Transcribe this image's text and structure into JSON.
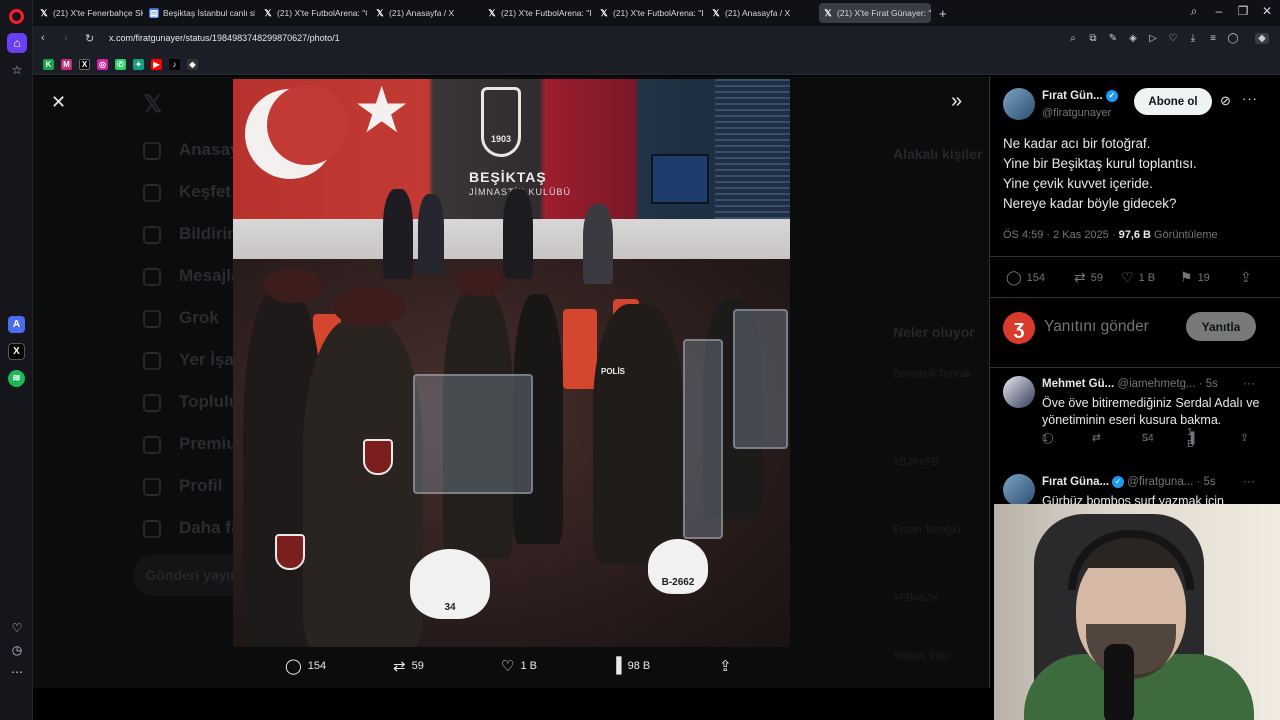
{
  "browser": {
    "tabs": [
      {
        "label": "(21) X'te Fenerbahçe SK: \"",
        "icon": "x-icon",
        "active": false
      },
      {
        "label": "Beşiktaş İstanbul canlı skor",
        "icon": "news-icon",
        "active": false
      },
      {
        "label": "(21) X'te FutbolArena: \"Or",
        "icon": "x-icon",
        "active": false
      },
      {
        "label": "(21) Anasayfa / X",
        "icon": "x-icon",
        "active": false
      },
      {
        "label": "(21) X'te FutbolArena: \"Fe",
        "icon": "x-icon",
        "active": false
      },
      {
        "label": "(21) X'te FutbolArena: \"Be",
        "icon": "x-icon",
        "active": false
      },
      {
        "label": "(21) Anasayfa / X",
        "icon": "x-icon",
        "active": false
      },
      {
        "label": "(21) X'te Fırat Günayer: \"N",
        "icon": "x-icon",
        "active": true
      }
    ],
    "new_tab_label": "+",
    "url": "x.com/firatgunayer/status/1984983748299870627/photo/1"
  },
  "background_nav": [
    "Anasayfa",
    "Keşfet",
    "Bildirimler",
    "Mesajlar",
    "Grok",
    "Yer İşaretleri",
    "Topluluklar",
    "Premium",
    "Profil",
    "Daha fazla"
  ],
  "background_post_button": "Gönderi yayınla",
  "background_right": {
    "related_title": "Alakalı kişiler",
    "trends_title": "Neler oluyor",
    "trends": [
      "Benekoll Toprak",
      "#BJKvFB",
      "Ersan Toroğlu",
      "#FBvBJK",
      "Selçuk İnan"
    ]
  },
  "photo_stats": {
    "replies": "154",
    "reposts": "59",
    "likes": "1 B",
    "views": "98 B"
  },
  "tweet": {
    "author_name": "Fırat Gün...",
    "author_handle": "@firatgunayer",
    "follow_label": "Abone ol",
    "text_lines": [
      "Ne kadar acı bir fotoğraf.",
      "Yine bir Beşiktaş kurul toplantısı.",
      "Yine çevik kuvvet içeride.",
      "Nereye kadar böyle gidecek?"
    ],
    "time": "ÖS 4:59 · 2 Kas 2025 · ",
    "views_count": "97,6 B",
    "views_label": " Görüntüleme",
    "replies": "154",
    "reposts": "59",
    "likes": "1 B",
    "bookmarks": "19",
    "reply_placeholder": "Yanıtını gönder",
    "reply_button": "Yanıtla"
  },
  "replies": [
    {
      "name": "Mehmet Gü...",
      "handle": "@iamehmetg...",
      "time": "· 5s",
      "text": "Öve öve bitiremediğiniz Serdal Adalı ve yönetiminin eseri kusura bakma.",
      "replies": "1",
      "reposts": "",
      "likes": "54",
      "views": "1 B"
    },
    {
      "name": "Fırat Güna...",
      "handle": "@firatguna...",
      "time": "· 5s",
      "text": "Gürbüz bombos surf yazmak için",
      "replies": "",
      "reposts": "",
      "likes": "",
      "views": ""
    }
  ],
  "photo_text": {
    "club": "BEŞİKTAŞ",
    "club_sub": "JİMNASTİK KULÜBÜ",
    "crest": "1903",
    "polis": "POLİS",
    "helmet1": "34",
    "helmet2": "B-2662"
  },
  "colors": {
    "x_blue": "#1d9bf0",
    "opera_red": "#ff1b2d",
    "opera_active": "#6b3ff2",
    "text_primary": "#e7e9ea",
    "text_secondary": "#71767b"
  }
}
